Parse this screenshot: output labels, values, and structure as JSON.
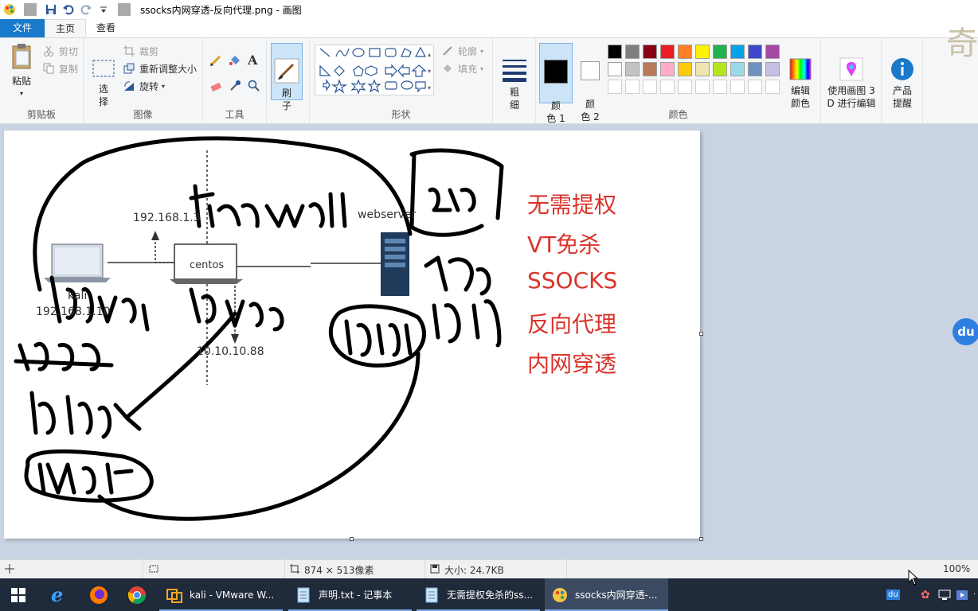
{
  "window": {
    "title": "ssocks内网穿透-反向代理.png - 画图"
  },
  "tabs": [
    {
      "label": "文件"
    },
    {
      "label": "主页"
    },
    {
      "label": "查看"
    }
  ],
  "clipboard": {
    "paste": "粘贴",
    "cut": "剪切",
    "copy": "复制",
    "label": "剪贴板"
  },
  "image": {
    "select": "选\n择",
    "crop": "裁剪",
    "resize": "重新调整大小",
    "rotate": "旋转",
    "label": "图像"
  },
  "tools": {
    "label": "工具"
  },
  "brush": {
    "label": "刷\n子"
  },
  "shapes": {
    "outline": "轮廓",
    "fill": "填充",
    "label": "形状"
  },
  "size": {
    "label": "粗\n细"
  },
  "colors": {
    "color1": "颜\n色 1",
    "color2": "颜\n色 2",
    "edit": "编辑\n颜色",
    "paint3d": "使用画图 3\nD 进行编辑",
    "tips": "产品\n提醒",
    "label": "颜色",
    "row1": [
      "#000000",
      "#7f7f7f",
      "#880015",
      "#ed1c24",
      "#ff7f27",
      "#fff200",
      "#22b14c",
      "#00a2e8",
      "#3f48cc",
      "#a349a4"
    ],
    "row2": [
      "#ffffff",
      "#c3c3c3",
      "#b97a57",
      "#ffaec9",
      "#ffc90e",
      "#efe4b0",
      "#b5e61d",
      "#99d9ea",
      "#7092be",
      "#c8bfe7"
    ]
  },
  "canvas_content": {
    "ip1": "192.168.1.3",
    "centos": "centos",
    "webserver": "webserver",
    "kali": "kali",
    "ip_kali": "192.168.1.10",
    "ip2": "10.10.10.88",
    "red_lines": [
      "无需提权",
      "VT免杀",
      "SSOCKS",
      "反向代理",
      "内网穿透"
    ]
  },
  "status": {
    "dimensions": "874 × 513像素",
    "size": "大小: 24.7KB",
    "zoom": "100%"
  },
  "taskbar": {
    "items": [
      {
        "label": "kali - VMware W..."
      },
      {
        "label": "声明.txt - 记事本"
      },
      {
        "label": "无需提权免杀的ss..."
      },
      {
        "label": "ssocks内网穿透-..."
      }
    ]
  },
  "side_badge": "du",
  "corner_char": "奇"
}
